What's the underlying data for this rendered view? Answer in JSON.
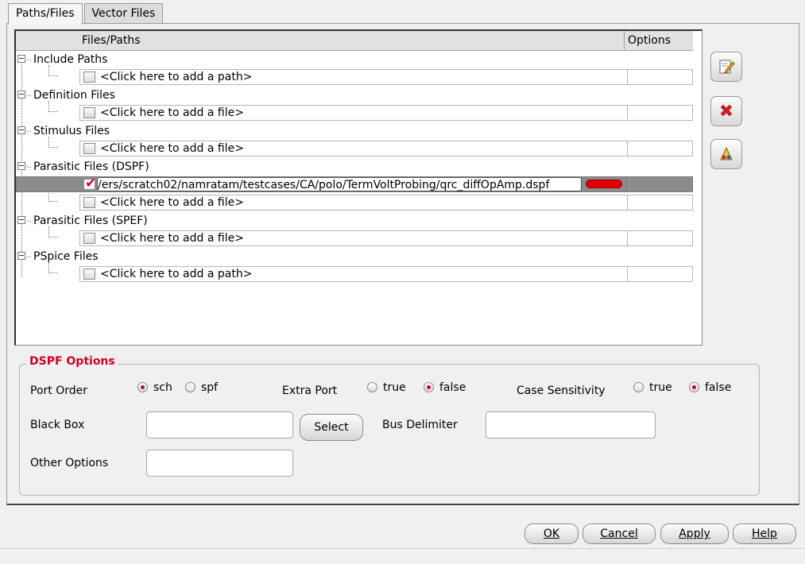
{
  "tabs": [
    {
      "label": "Paths/Files"
    },
    {
      "label": "Vector Files"
    }
  ],
  "tree": {
    "header_files": "Files/Paths",
    "header_options": "Options",
    "groups": [
      {
        "label": "Include Paths",
        "row": "<Click here to add a path>"
      },
      {
        "label": "Definition Files",
        "row": "<Click here to add a file>"
      },
      {
        "label": "Stimulus Files",
        "row": "<Click here to add a file>"
      },
      {
        "label": "Parasitic Files (DSPF)",
        "selected_path": "/ers/scratch02/namratam/testcases/CA/polo/TermVoltProbing/qrc_diffOpAmp.dspf",
        "row": "<Click here to add a file>"
      },
      {
        "label": "Parasitic Files (SPEF)",
        "row": "<Click here to add a file>"
      },
      {
        "label": "PSpice Files",
        "row": "<Click here to add a path>"
      }
    ]
  },
  "side_icons": [
    "edit-icon",
    "delete-icon",
    "properties-icon"
  ],
  "dspf": {
    "title": "DSPF Options",
    "port_order_label": "Port Order",
    "port_order_opts": [
      "sch",
      "spf"
    ],
    "extra_port_label": "Extra Port",
    "case_label": "Case Sensitivity",
    "bool_opts": [
      "true",
      "false"
    ],
    "black_box_label": "Black Box",
    "select_label": "Select",
    "bus_delim_label": "Bus Delimiter",
    "other_label": "Other Options"
  },
  "footer": {
    "ok": "OK",
    "cancel": "Cancel",
    "apply": "Apply",
    "help": "Help"
  },
  "colors": {
    "accent": "#d0002a",
    "selection": "#8c8c8c"
  }
}
